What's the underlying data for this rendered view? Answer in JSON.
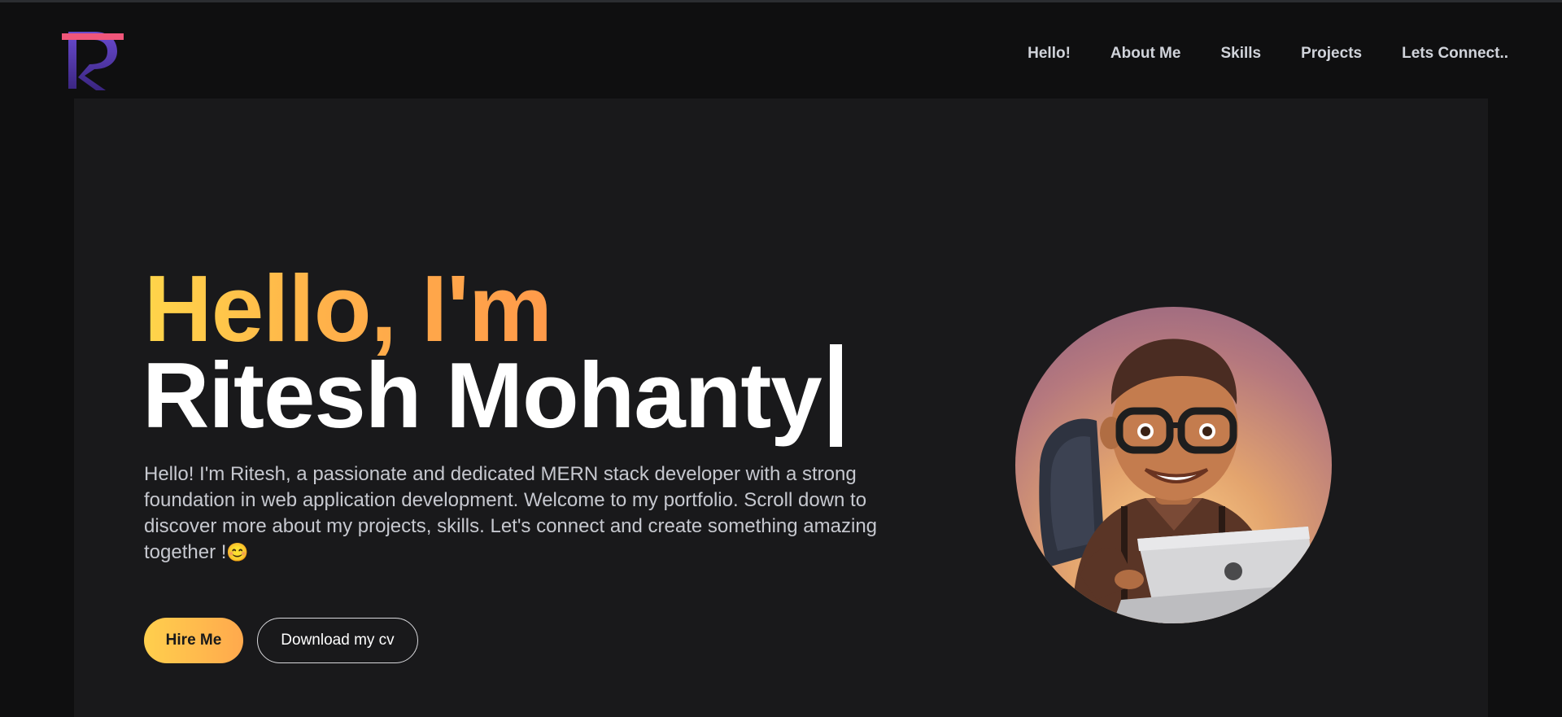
{
  "nav": {
    "logo_alt": "R",
    "links": [
      "Hello!",
      "About Me",
      "Skills",
      "Projects",
      "Lets Connect.."
    ]
  },
  "hero": {
    "greeting": "Hello, I'm",
    "name": "Ritesh Mohanty",
    "intro": "Hello! I'm Ritesh, a passionate and dedicated MERN stack developer with a strong foundation in web application development. Welcome to my portfolio. Scroll down to discover more about my projects, skills. Let's connect and create something amazing together !",
    "intro_emoji": "😊",
    "hire_label": "Hire Me",
    "cv_label": "Download my cv",
    "avatar_desc": "3D cartoon avatar of developer with glasses working on laptop"
  },
  "colors": {
    "background": "#0f0f10",
    "hero_bg": "#19191b",
    "accent_start": "#ffd54a",
    "accent_end": "#ff9a4a",
    "logo_pink": "#f0567a",
    "logo_purple": "#5a3bb5"
  }
}
